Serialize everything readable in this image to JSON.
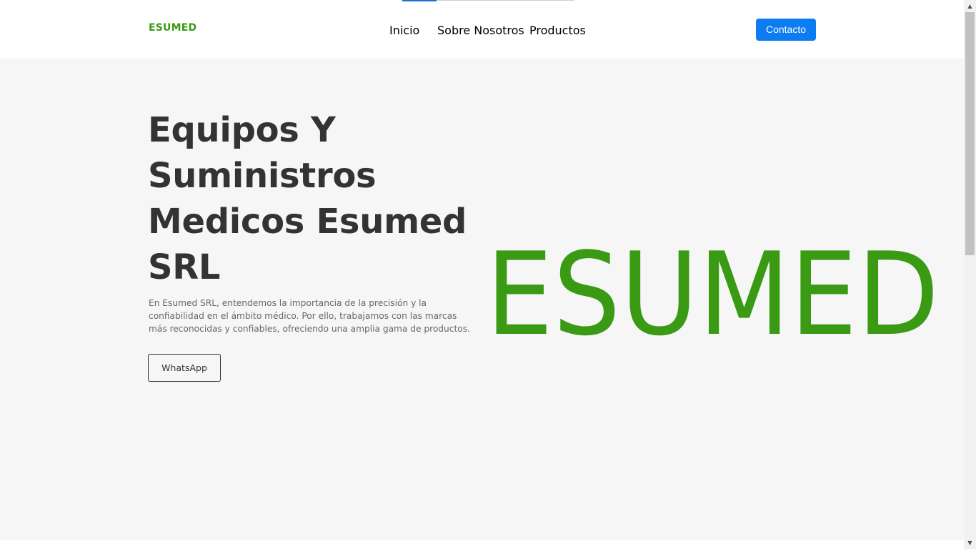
{
  "header": {
    "logo": "ESUMED",
    "nav": [
      {
        "label": "Inicio"
      },
      {
        "label": "Sobre Nosotros"
      },
      {
        "label": "Productos"
      }
    ],
    "contact_label": "Contacto"
  },
  "hero": {
    "title": "Equipos Y Suministros Medicos Esumed SRL",
    "description": "En Esumed SRL, entendemos la importancia de la precisión y la confiabilidad en el ámbito médico. Por ello, trabajamos con las marcas más reconocidas y confiables, ofreciendo una amplia gama de productos.",
    "whatsapp_label": "WhatsApp",
    "brand_mark": "ESUMED"
  },
  "colors": {
    "brand_green": "#3a9a14",
    "primary_blue": "#0d7bf2",
    "hero_bg": "#f6f6f6",
    "text_dark": "#333333"
  },
  "icons": {
    "scroll_up": "scroll-up-arrow-icon",
    "scroll_down": "scroll-down-arrow-icon"
  }
}
